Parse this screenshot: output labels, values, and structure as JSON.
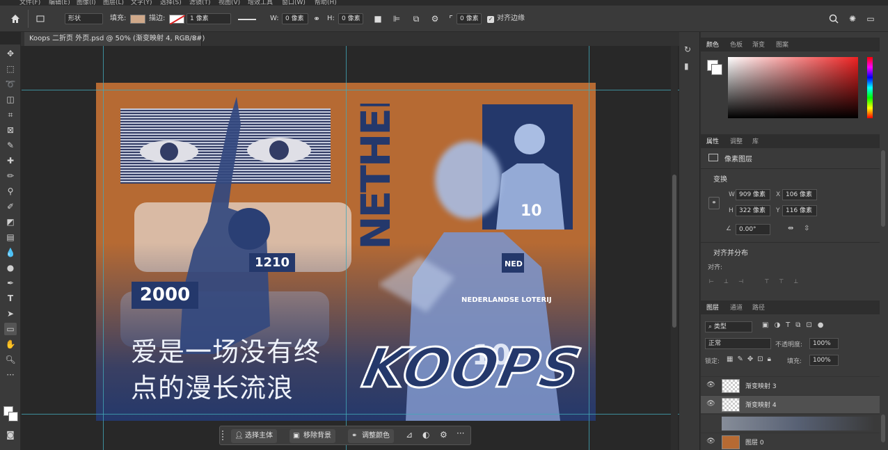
{
  "menu": [
    "文件(F)",
    "编辑(E)",
    "图像(I)",
    "图层(L)",
    "文字(Y)",
    "选择(S)",
    "滤镜(T)",
    "视图(V)",
    "增效工具",
    "窗口(W)",
    "帮助(H)"
  ],
  "options": {
    "shape_mode": "形状",
    "fill_label": "填充:",
    "stroke_label": "描边:",
    "stroke_width": "1 像素",
    "w_label": "W:",
    "w_value": "0 像素",
    "h_label": "H:",
    "h_value": "0 像素",
    "radius_value": "0 像素",
    "align_edges": "对齐边缘"
  },
  "document_tab": "Koops 二折页 外页.psd @ 50% (渐变映射 4, RGB/8#)",
  "artwork": {
    "stat_2000": "2000",
    "stat_1210": "1210",
    "poem_line1": "爱是一场没有终",
    "poem_line2": "点的漫长流浪",
    "vertical_text": "NETHERLANDS",
    "player_name": "KOOPS",
    "jersey_number": "10",
    "jersey_badge": "NED",
    "jersey_sponsor": "NEDERLANDSE LOTERIJ"
  },
  "color_panel": {
    "tabs": [
      "颜色",
      "色板",
      "渐变",
      "图案"
    ],
    "active": 0
  },
  "properties_panel": {
    "tabs": [
      "属性",
      "调整",
      "库"
    ],
    "active": 0,
    "layer_type": "像素图层",
    "transform_title": "变换",
    "w_label": "W",
    "w_value": "909 像素",
    "x_label": "X",
    "x_value": "106 像素",
    "h_label": "H",
    "h_value": "322 像素",
    "y_label": "Y",
    "y_value": "116 像素",
    "angle_value": "0.00°",
    "align_title": "对齐并分布",
    "align_label": "对齐:"
  },
  "layers_panel": {
    "tabs": [
      "图层",
      "通道",
      "路径"
    ],
    "active": 0,
    "filter_kind": "类型",
    "blend_mode": "正常",
    "opacity_label": "不透明度:",
    "opacity_value": "100%",
    "lock_label": "锁定:",
    "fill_label": "填充:",
    "fill_value": "100%",
    "layers": [
      {
        "name": "渐变映射 3",
        "selected": false
      },
      {
        "name": "渐变映射 4",
        "selected": true
      },
      {
        "name": "图层 0",
        "selected": false
      }
    ]
  },
  "contextual_bar": {
    "select_subject": "选择主体",
    "remove_bg": "移除背景",
    "adjust_color": "调整颜色"
  },
  "colors": {
    "artboard_orange": "#b66a33",
    "duotone_blue": "#24386b",
    "light_blue": "#c7d6f0"
  }
}
